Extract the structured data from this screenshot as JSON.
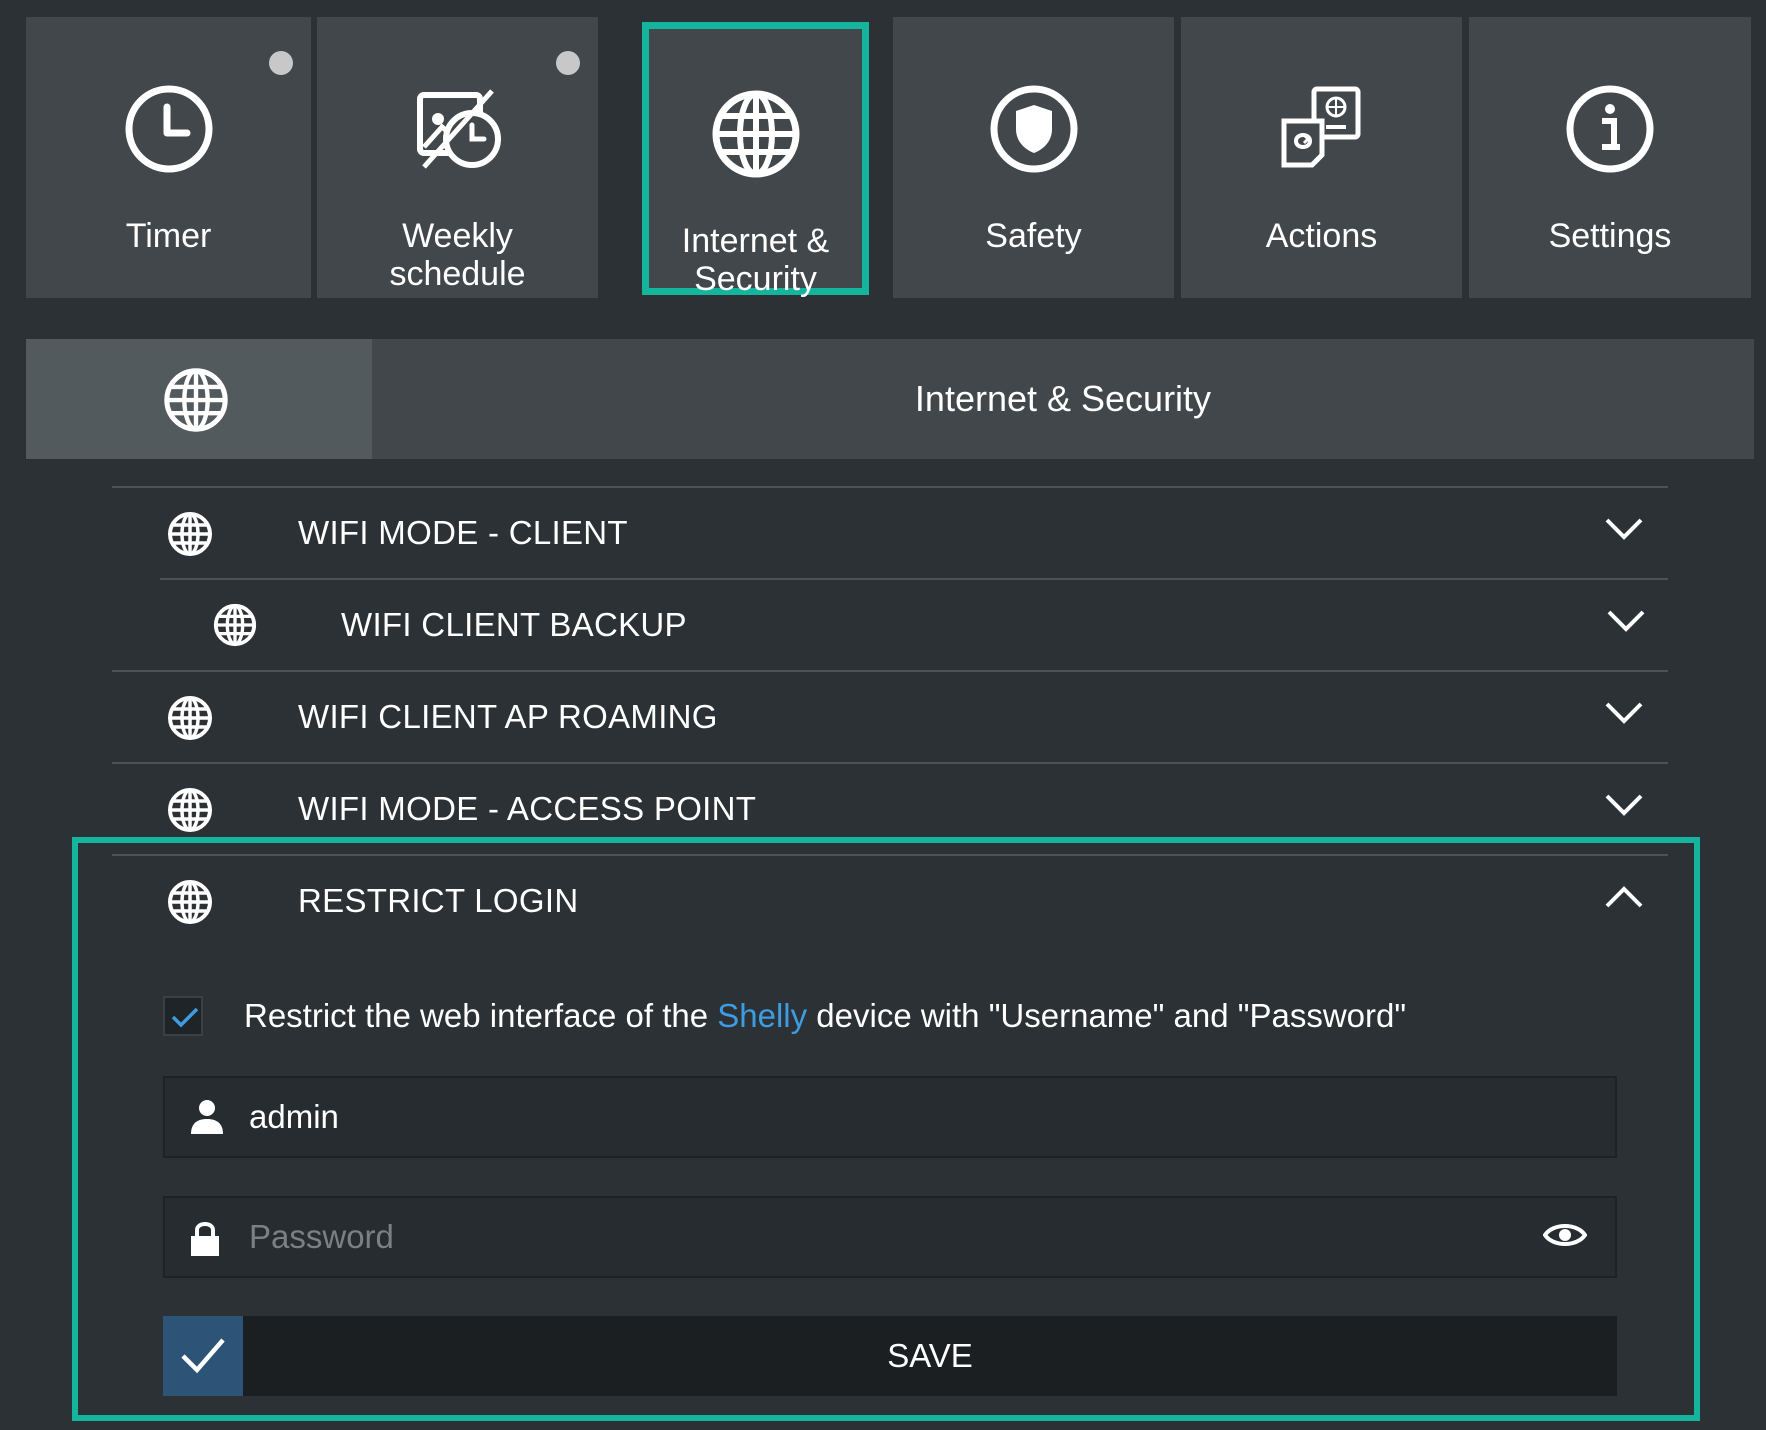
{
  "tiles": [
    {
      "label": "Timer",
      "icon": "clock-icon",
      "dot": true
    },
    {
      "label": "Weekly schedule",
      "icon": "calendar-icon",
      "dot": true
    },
    {
      "label": "Internet & Security",
      "icon": "globe-icon",
      "active": true
    },
    {
      "label": "Safety",
      "icon": "shield-icon"
    },
    {
      "label": "Actions",
      "icon": "actions-icon"
    },
    {
      "label": "Settings",
      "icon": "info-icon"
    }
  ],
  "header": {
    "title": "Internet & Security",
    "icon": "globe-icon"
  },
  "sections": [
    {
      "label": "WIFI MODE - CLIENT",
      "icon": "globe-icon",
      "expanded": false
    },
    {
      "label": "WIFI CLIENT BACKUP",
      "icon": "globe-icon",
      "expanded": false
    },
    {
      "label": "WIFI CLIENT AP ROAMING",
      "icon": "globe-icon",
      "expanded": false
    },
    {
      "label": "WIFI MODE - ACCESS POINT",
      "icon": "globe-icon",
      "expanded": false
    },
    {
      "label": "RESTRICT LOGIN",
      "icon": "globe-icon",
      "expanded": true
    }
  ],
  "restrict": {
    "checked": true,
    "text_before": "Restrict the web interface of the ",
    "brand": "Shelly",
    "text_after": " device with \"Username\" and \"Password\"",
    "username_value": "admin",
    "password_placeholder": "Password",
    "save_label": "SAVE"
  },
  "colors": {
    "accent": "#14b59c",
    "background": "#2b3134",
    "tile": "#41474b",
    "link": "#3d9de0",
    "save_check": "#2d5377"
  }
}
